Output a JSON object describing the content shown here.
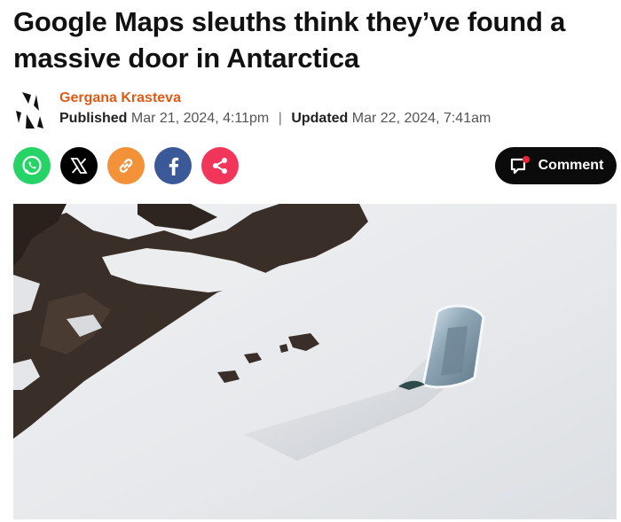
{
  "article": {
    "headline": "Google Maps sleuths think they’ve found a massive door in Antarctica",
    "author": "Gergana Krasteva",
    "published_label": "Published",
    "published_date": "Mar 21, 2024, 4:11pm",
    "separator": "|",
    "updated_label": "Updated",
    "updated_date": "Mar 22, 2024, 7:41am"
  },
  "share": {
    "buttons": [
      {
        "icon": "whatsapp-icon",
        "color": "#25d366"
      },
      {
        "icon": "x-icon",
        "color": "#000000"
      },
      {
        "icon": "link-icon",
        "color": "#f4923a"
      },
      {
        "icon": "facebook-icon",
        "color": "#3b5998"
      },
      {
        "icon": "share-icon",
        "color": "#f2355a"
      }
    ],
    "comment_label": "Comment"
  },
  "colors": {
    "author": "#e05a14",
    "comment_dot": "#e8253a"
  }
}
